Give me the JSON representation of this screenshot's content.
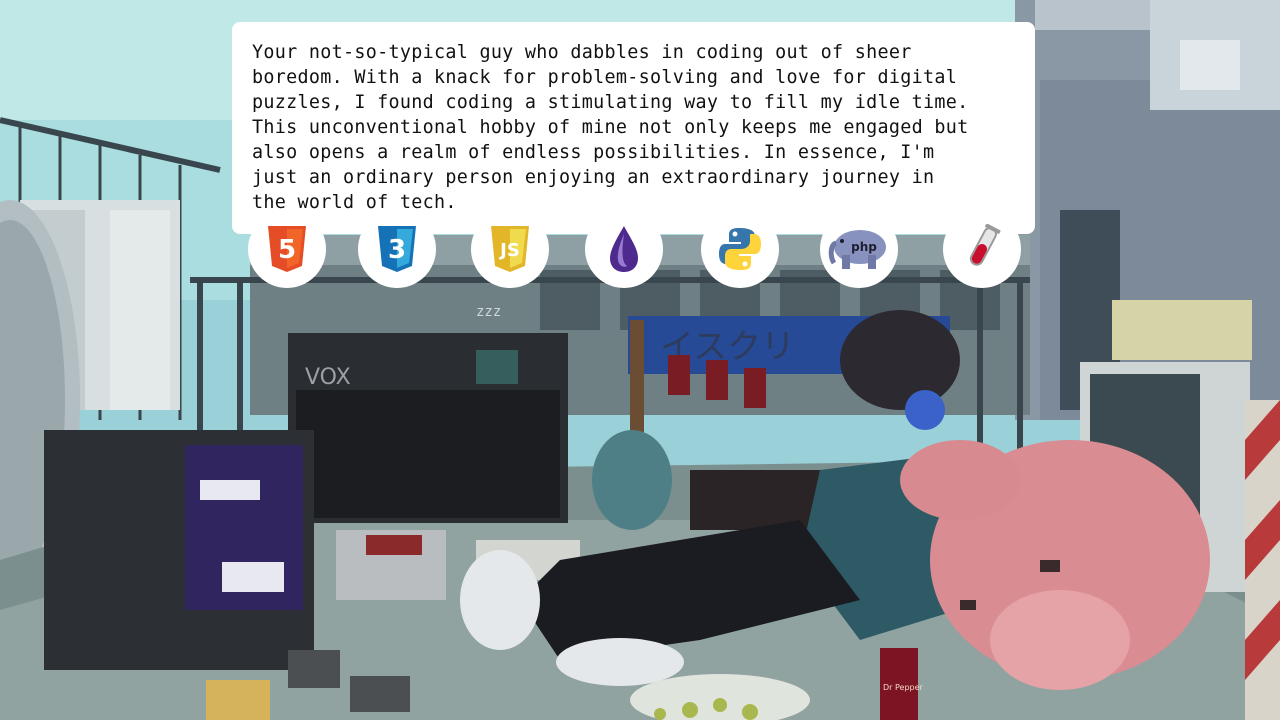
{
  "bio": {
    "text": "Your not-so-typical guy who dabbles in coding out of sheer\nboredom. With a knack for problem-solving and love for digital\npuzzles, I found coding a stimulating way to fill my idle time.\nThis unconventional hobby of mine not only keeps me engaged but\nalso opens a realm of endless possibilities. In essence, I'm\njust an ordinary person enjoying an extraordinary journey in\nthe world of tech."
  },
  "tech_icons": [
    {
      "icon": "html5-icon",
      "badge": "5",
      "color": "#e44d26"
    },
    {
      "icon": "css3-icon",
      "badge": "3",
      "color": "#1572b6"
    },
    {
      "icon": "javascript-icon",
      "badge": "JS",
      "color": "#f0db4f"
    },
    {
      "icon": "elixir-icon",
      "color": "#4e2a8e"
    },
    {
      "icon": "python-icon",
      "colors": [
        "#3776ab",
        "#ffd43b"
      ]
    },
    {
      "icon": "php-icon",
      "badge": "php",
      "color": "#8892be"
    },
    {
      "icon": "test-tube-icon",
      "color": "#c8102e"
    }
  ],
  "scene": {
    "amp_label": "VOX",
    "banner_text": "イスクリ",
    "can_label": "Dr Pepper",
    "sleep_text": "zzz"
  }
}
